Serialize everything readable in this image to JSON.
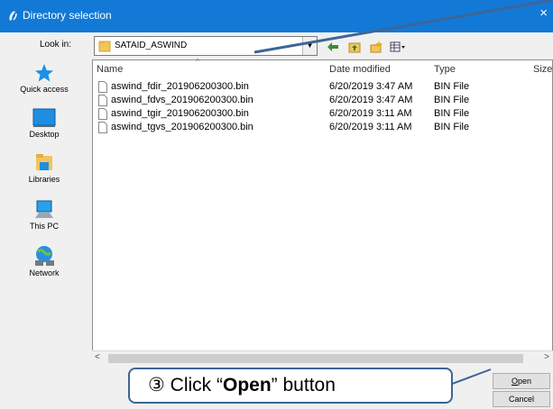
{
  "window": {
    "title": "Directory selection",
    "close_glyph": "×"
  },
  "lookin": {
    "label": "Look in:",
    "value": "SATAID_ASWIND"
  },
  "places": [
    {
      "label": "Quick access",
      "icon": "star-icon"
    },
    {
      "label": "Desktop",
      "icon": "desktop-icon"
    },
    {
      "label": "Libraries",
      "icon": "libraries-icon"
    },
    {
      "label": "This PC",
      "icon": "computer-icon"
    },
    {
      "label": "Network",
      "icon": "network-icon"
    }
  ],
  "columns": {
    "name": "Name",
    "date": "Date modified",
    "type": "Type",
    "size": "Size"
  },
  "files": [
    {
      "name": "aswind_fdir_201906200300.bin",
      "date": "6/20/2019 3:47 AM",
      "type": "BIN File"
    },
    {
      "name": "aswind_fdvs_201906200300.bin",
      "date": "6/20/2019 3:47 AM",
      "type": "BIN File"
    },
    {
      "name": "aswind_tgir_201906200300.bin",
      "date": "6/20/2019 3:11 AM",
      "type": "BIN File"
    },
    {
      "name": "aswind_tgvs_201906200300.bin",
      "date": "6/20/2019 3:11 AM",
      "type": "BIN File"
    }
  ],
  "buttons": {
    "open_mnemonic": "O",
    "open_rest": "pen",
    "cancel": "Cancel"
  },
  "callout": {
    "prefix": "③ Click “",
    "bold": "Open",
    "suffix": "” button"
  },
  "colors": {
    "titlebar": "#1279d6",
    "callout_border": "#3d6596",
    "arrow": "#3d6596"
  }
}
